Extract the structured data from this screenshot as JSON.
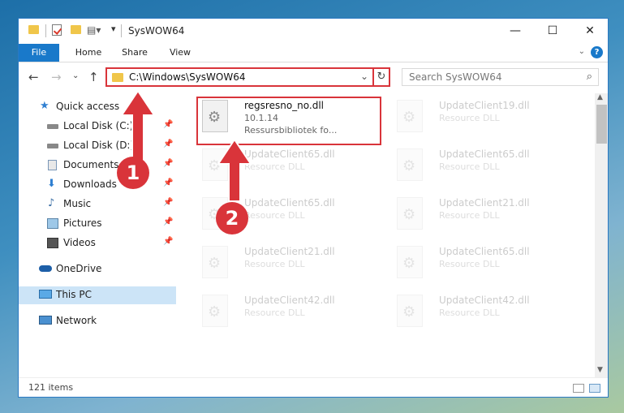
{
  "window": {
    "title": "SysWOW64"
  },
  "controls": {
    "minimize": "—",
    "maximize": "☐",
    "close": "✕"
  },
  "ribbon": {
    "tabs": [
      "File",
      "Home",
      "Share",
      "View"
    ],
    "help": "?"
  },
  "address": {
    "path": "C:\\Windows\\SysWOW64",
    "search_placeholder": "Search SysWOW64"
  },
  "sidebar": {
    "items": [
      {
        "label": "Quick access",
        "icon": "star-icon"
      },
      {
        "label": "Local Disk (C:)",
        "icon": "drive-icon"
      },
      {
        "label": "Local Disk (D:)",
        "icon": "drive-icon"
      },
      {
        "label": "Documents",
        "icon": "documents-icon"
      },
      {
        "label": "Downloads",
        "icon": "download-icon"
      },
      {
        "label": "Music",
        "icon": "music-icon"
      },
      {
        "label": "Pictures",
        "icon": "pictures-icon"
      },
      {
        "label": "Videos",
        "icon": "videos-icon"
      },
      {
        "label": "OneDrive",
        "icon": "cloud-icon"
      },
      {
        "label": "This PC",
        "icon": "computer-icon"
      },
      {
        "label": "Network",
        "icon": "network-icon"
      }
    ]
  },
  "files": [
    {
      "name": "regsresno_no.dll",
      "line2": "10.1.14",
      "line3": "Ressursbibliotek fo..."
    },
    {
      "name": "UpdateClient19.dll",
      "line2": "Resource DLL"
    },
    {
      "name": "UpdateClient65.dll",
      "line2": "Resource DLL"
    },
    {
      "name": "UpdateClient65.dll",
      "line2": "Resource DLL"
    },
    {
      "name": "UpdateClient65.dll",
      "line2": "Resource DLL"
    },
    {
      "name": "UpdateClient21.dll",
      "line2": "Resource DLL"
    },
    {
      "name": "UpdateClient21.dll",
      "line2": "Resource DLL"
    },
    {
      "name": "UpdateClient65.dll",
      "line2": "Resource DLL"
    },
    {
      "name": "UpdateClient42.dll",
      "line2": "Resource DLL"
    },
    {
      "name": "UpdateClient42.dll",
      "line2": "Resource DLL"
    }
  ],
  "status": {
    "count": "121 items"
  },
  "callouts": [
    "1",
    "2"
  ],
  "colors": {
    "accent": "#1979ca",
    "highlight": "#d9343a"
  }
}
